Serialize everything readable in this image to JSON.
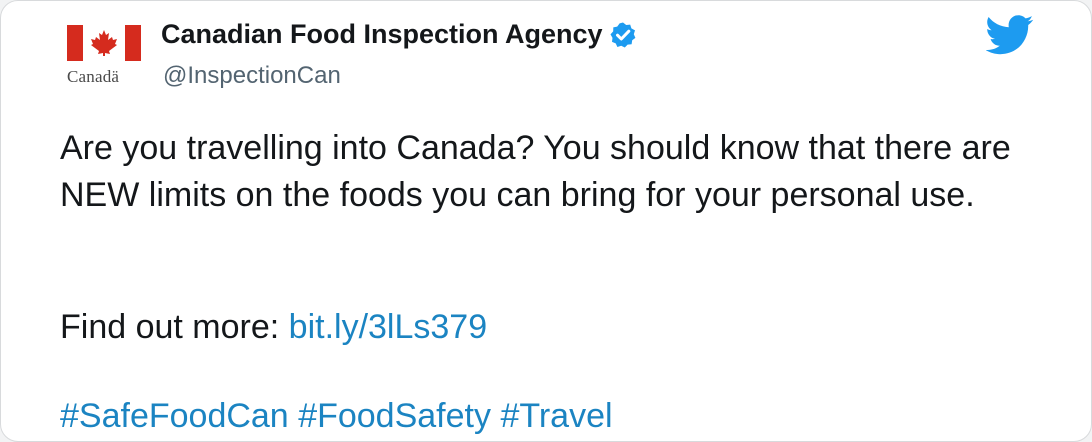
{
  "account": {
    "display_name": "Canadian Food Inspection Agency",
    "handle": "@InspectionCan",
    "wordmark": "Canadä",
    "verified": true,
    "avatar_icon": "canada-flag-icon",
    "platform_icon": "twitter-bird-icon"
  },
  "tweet": {
    "paragraph_1": "Are you travelling into Canada? You should know that there are NEW limits on the foods you can bring for your personal use.",
    "link_prefix": "Find out more:",
    "link_text": "bit.ly/3lLs379",
    "hashtags": [
      "#SafeFoodCan",
      "#FoodSafety",
      "#Travel"
    ]
  },
  "colors": {
    "link": "#1b84c2",
    "verified": "#1d9bf0",
    "twitter_blue": "#1d9bf0",
    "flag_red": "#d52b1e",
    "handle_gray": "#536471"
  }
}
